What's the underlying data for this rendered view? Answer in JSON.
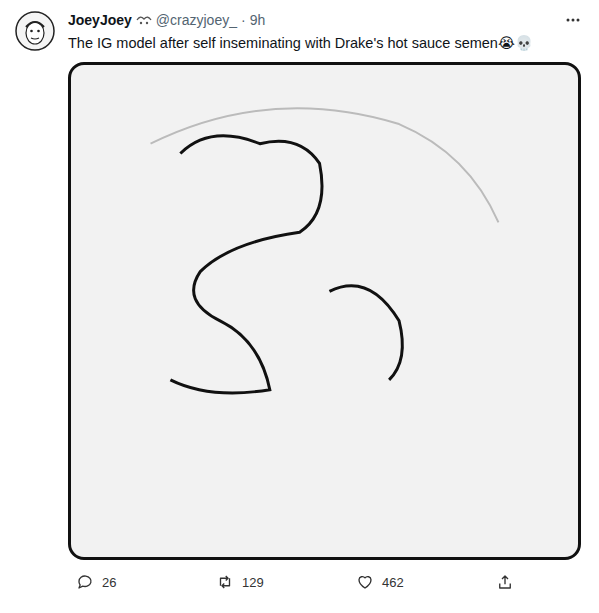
{
  "author": {
    "name": "JoeyJoey",
    "handle": "@crazyjoey_",
    "separator": "·",
    "time": "9h"
  },
  "tweet": {
    "text": "The IG model after self inseminating with Drake's hot sauce semen😭💀"
  },
  "actions": [
    {
      "kind": "reply",
      "count": "26"
    },
    {
      "kind": "retweet",
      "count": "129"
    },
    {
      "kind": "like",
      "count": "462"
    },
    {
      "kind": "share",
      "count": ""
    }
  ]
}
